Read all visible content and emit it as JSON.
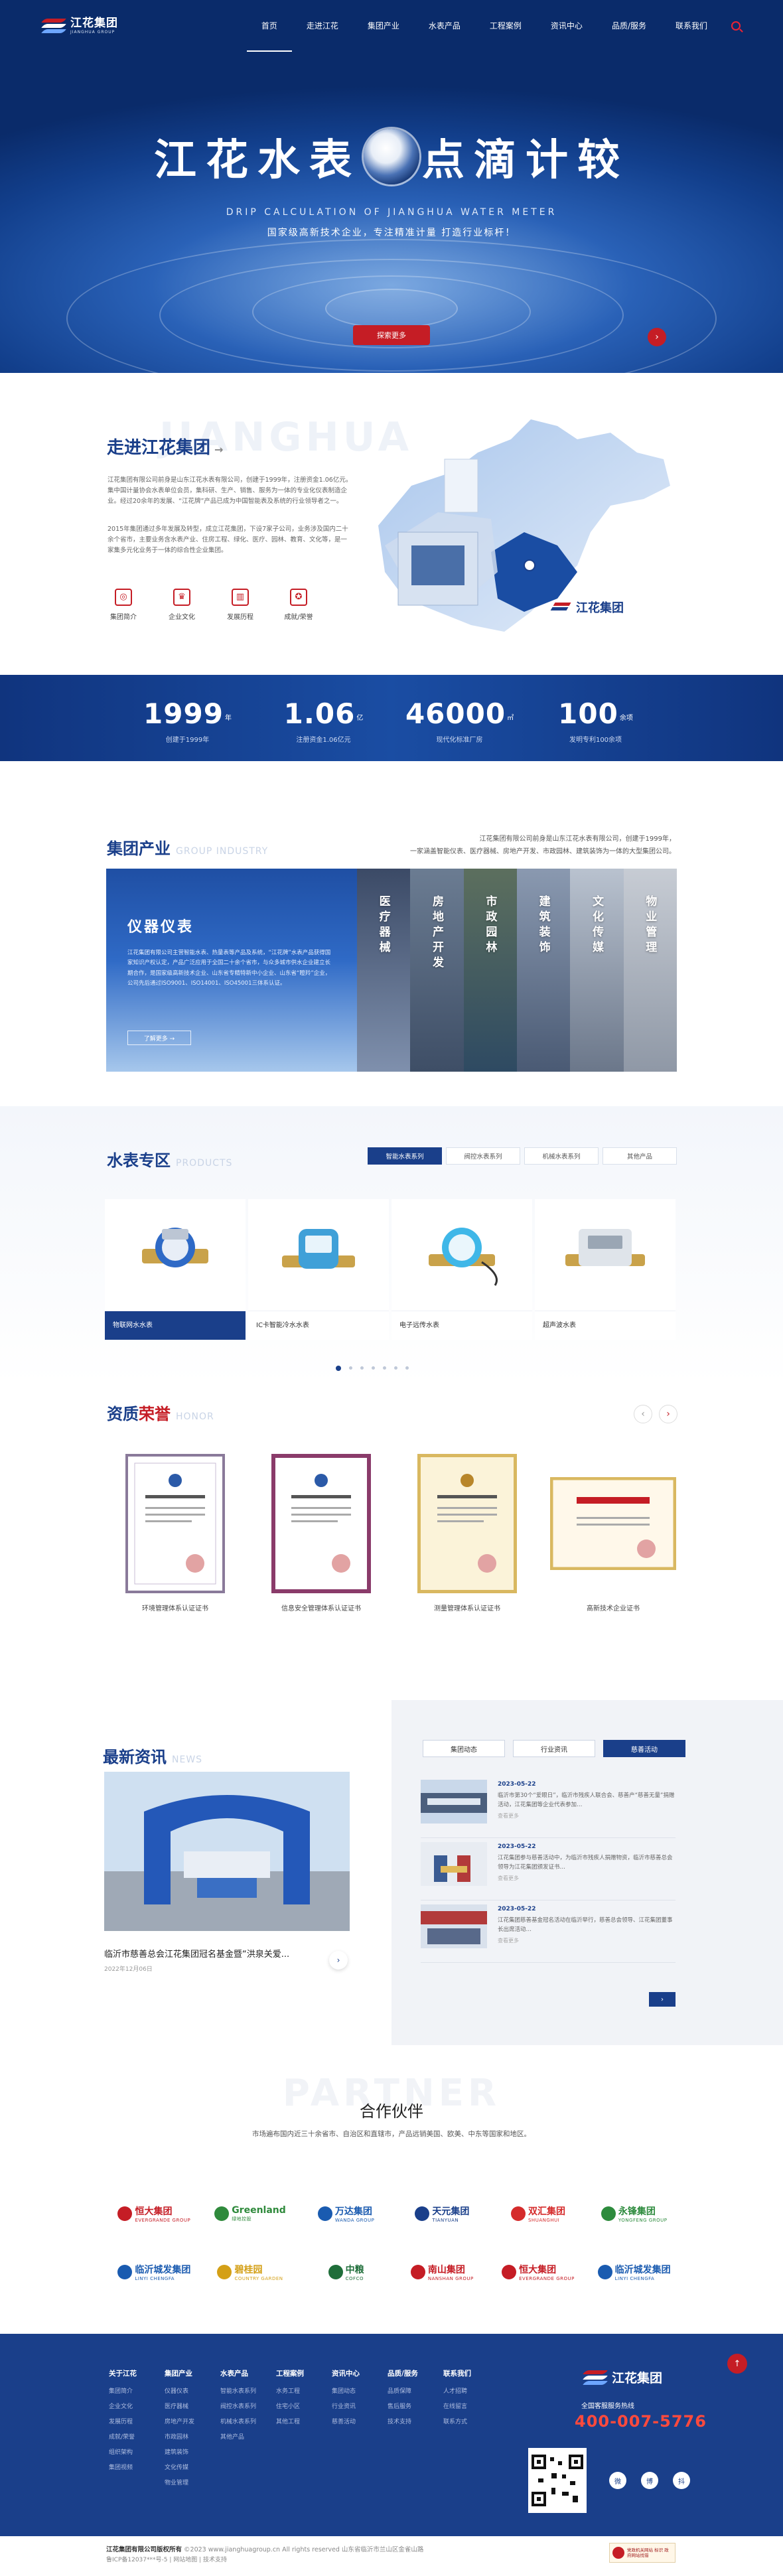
{
  "header": {
    "brand_cn": "江花集团",
    "brand_en": "JIANGHUA GROUP",
    "nav": [
      "首页",
      "走进江花",
      "集团产业",
      "水表产品",
      "工程案例",
      "资讯中心",
      "品质/服务",
      "联系我们"
    ],
    "active_nav": "首页"
  },
  "hero": {
    "title_left": "江花水表",
    "title_right": "点滴计较",
    "title_en": "DRIP CALCULATION OF JIANGHUA WATER METER",
    "subtitle": "国家级高新技术企业，专注精准计量 打造行业标杆！",
    "button": "探索更多"
  },
  "about": {
    "ghost": "JIANGHUA",
    "title": "走进江花集团",
    "p1": "江花集团有限公司前身是山东江花水表有限公司，创建于1999年，注册资金1.06亿元。集中国计量协会水表单位会员，集科研、生产、销售、服务为一体的专业化仪表制造企业。经过20余年的发展、“江花牌”产品已成为中国智能表及系统的行业领导者之一。",
    "p2": "2015年集团通过多年发展及转型，成立江花集团，下设7家子公司，业务涉及国内二十余个省市，主要业务含水表产业、住房工程、绿化、医疗、园林、教育、文化等，是一家集多元化业务于一体的综合性企业集团。",
    "icons": [
      {
        "glyph": "◎",
        "label": "集团简介"
      },
      {
        "glyph": "♛",
        "label": "企业文化"
      },
      {
        "glyph": "▥",
        "label": "发展历程"
      },
      {
        "glyph": "✪",
        "label": "成就/荣誉"
      }
    ],
    "map_brand": "江花集团"
  },
  "stats": [
    {
      "num": "1999",
      "unit": "年",
      "label": "创建于1999年"
    },
    {
      "num": "1.06",
      "unit": "亿",
      "label": "注册资金1.06亿元"
    },
    {
      "num": "46000",
      "unit": "㎡",
      "label": "现代化标准厂房"
    },
    {
      "num": "100",
      "unit": "余项",
      "label": "发明专利100余项"
    }
  ],
  "industry": {
    "title": "集团产业",
    "title_en": "GROUP INDUSTRY",
    "desc1": "江花集团有限公司前身是山东江花水表有限公司，创建于1999年，",
    "desc2": "一家涵盖智能仪表、医疗器械、房地产开发、市政园林、建筑装饰为一体的大型集团公司。",
    "main_title": "仪器仪表",
    "main_text": "江花集团有限公司主营智能水表、热量表等产品及系统，“江花牌”水表产品获得国家知识产权认定，产品广泛应用于全国二十余个省市，与众多城市供水企业建立长期合作，是国家级高新技术企业、山东省专精特新中小企业、山东省“瞪羚”企业，公司先后通过ISO9001、ISO14001、ISO45001三体系认证。",
    "main_more": "了解更多 →",
    "cols": [
      "医疗器械",
      "房地产开发",
      "市政园林",
      "建筑装饰",
      "文化传媒",
      "物业管理"
    ]
  },
  "products": {
    "title": "水表专区",
    "title_en": "PRODUCTS",
    "tabs": [
      "智能水表系列",
      "阀控水表系列",
      "机械水表系列",
      "其他产品"
    ],
    "items": [
      "物联网水水表",
      "IC卡智能冷水水表",
      "电子远传水表",
      "超声波水表"
    ]
  },
  "honor": {
    "title_a": "资质",
    "title_b": "荣誉",
    "title_en": "HONOR",
    "items": [
      "环境管理体系认证证书",
      "信息安全管理体系认证证书",
      "测量管理体系认证证书",
      "高新技术企业证书"
    ]
  },
  "news": {
    "title": "最新资讯",
    "title_en": "NEWS",
    "big_title": "临沂市慈善总会江花集团冠名基金暨“洪泉关爱...",
    "big_date": "2022年12月06日",
    "tabs": [
      "集团动态",
      "行业资讯",
      "慈善活动"
    ],
    "list": [
      {
        "date": "2023-05-22",
        "text": "临沂市第30个“爱眼日”，临沂市残疾人联合会、慈善产“慈善无量”捐赠活动，江花集团等企业代表参加…",
        "more": "查看更多"
      },
      {
        "date": "2023-05-22",
        "text": "江花集团参与慈善活动中，为临沂市残疾人捐赠物资，临沂市慈善总会领导为江花集团颁发证书…",
        "more": "查看更多"
      },
      {
        "date": "2023-05-22",
        "text": "江花集团慈善基金冠名活动在临沂举行，慈善总会领导、江花集团董事长出席活动…",
        "more": "查看更多"
      }
    ]
  },
  "partner": {
    "ghost": "PARTNER",
    "title": "合作伙伴",
    "subtitle": "市场遍布国内近三十余省市、自治区和直辖市，产品远销美国、欧美、中东等国家和地区。",
    "logos": [
      {
        "name": "恒大集团",
        "en": "EVERGRANDE GROUP",
        "color": "#c51d25"
      },
      {
        "name": "Greenland",
        "en": "绿地控股",
        "color": "#2f8a3c"
      },
      {
        "name": "万达集团",
        "en": "WANDA GROUP",
        "color": "#1a5bb0"
      },
      {
        "name": "天元集团",
        "en": "TIANYUAN",
        "color": "#1a3f8a"
      },
      {
        "name": "双汇集团",
        "en": "SHUANGHUI",
        "color": "#d52b2b"
      },
      {
        "name": "永锋集团",
        "en": "YONGFENG GROUP",
        "color": "#2d8b3d"
      },
      {
        "name": "临沂城发集团",
        "en": "LINYI CHENGFA",
        "color": "#1a5bb0"
      },
      {
        "name": "碧桂园",
        "en": "COUNTRY GARDEN",
        "color": "#d4a017"
      },
      {
        "name": "中粮",
        "en": "COFCO",
        "color": "#1f6e3a"
      },
      {
        "name": "南山集团",
        "en": "NANSHAN GROUP",
        "color": "#c51d25"
      },
      {
        "name": "恒大集团",
        "en": "EVERGRANDE GROUP",
        "color": "#c51d25"
      },
      {
        "name": "临沂城发集团",
        "en": "LINYI CHENGFA",
        "color": "#1a5bb0"
      }
    ]
  },
  "footer": {
    "cols": [
      {
        "title": "关于江花",
        "links": [
          "集团简介",
          "企业文化",
          "发展历程",
          "成就/荣誉",
          "组织架构",
          "集团视频"
        ]
      },
      {
        "title": "集团产业",
        "links": [
          "仪器仪表",
          "医疗器械",
          "房地产开发",
          "市政园林",
          "建筑装饰",
          "文化传媒",
          "物业管理"
        ]
      },
      {
        "title": "水表产品",
        "links": [
          "智能水表系列",
          "阀控水表系列",
          "机械水表系列",
          "其他产品"
        ]
      },
      {
        "title": "工程案例",
        "links": [
          "水务工程",
          "住宅小区",
          "其他工程"
        ]
      },
      {
        "title": "资讯中心",
        "links": [
          "集团动态",
          "行业资讯",
          "慈善活动"
        ]
      },
      {
        "title": "品质/服务",
        "links": [
          "品质保障",
          "售后服务",
          "技术支持"
        ]
      },
      {
        "title": "联系我们",
        "links": [
          "人才招聘",
          "在线留言",
          "联系方式"
        ]
      }
    ],
    "brand": "江花集团",
    "hotline_label": "全国客服服务热线",
    "hotline": "400-007-5776",
    "socials": [
      "微",
      "博",
      "抖"
    ],
    "copyright": "江花集团有限公司版权所有",
    "copyright_extra": "©2023 www.jianghuagroup.cn  All rights reserved  山东省临沂市兰山区金雀山路",
    "icp": "鲁ICP备12037***号-5  |  网站地图  |  技术支持",
    "badge": "党政机关网站 标识 政府网站找错"
  },
  "colors": {
    "brand_blue": "#1a3f8a",
    "accent_red": "#c51d25"
  }
}
